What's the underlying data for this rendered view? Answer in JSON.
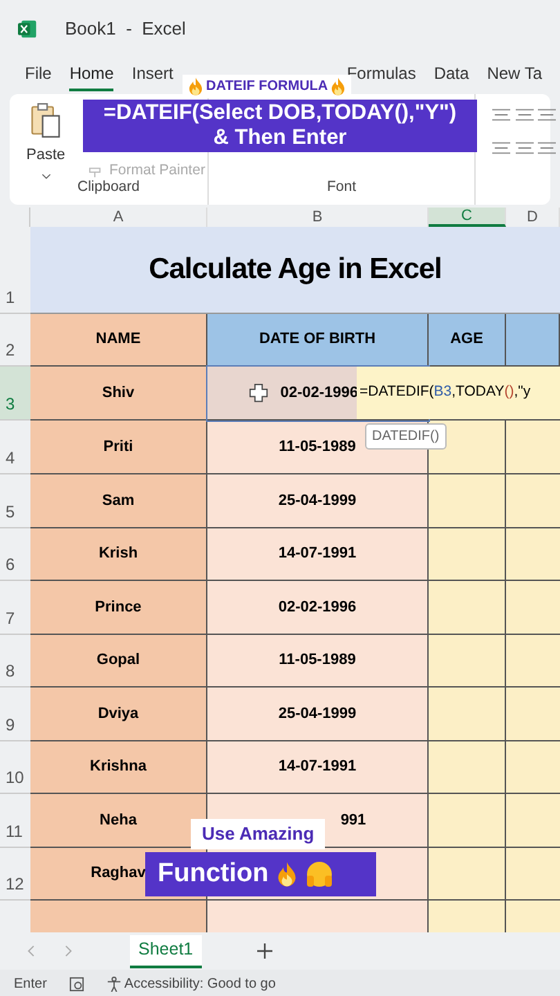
{
  "window": {
    "title": "Book1  -  Excel"
  },
  "ribbon_tabs": [
    {
      "label": "File",
      "selected": false
    },
    {
      "label": "Home",
      "selected": true
    },
    {
      "label": "Insert",
      "selected": false
    },
    {
      "label": "Formulas",
      "selected": false
    },
    {
      "label": "Data",
      "selected": false
    },
    {
      "label": "New Ta",
      "selected": false
    }
  ],
  "ribbon": {
    "paste": "Paste",
    "format_painter": "Format Painter",
    "groups": [
      "Clipboard",
      "Font"
    ]
  },
  "columns": [
    {
      "label": "A",
      "selected": false
    },
    {
      "label": "B",
      "selected": false
    },
    {
      "label": "C",
      "selected": true
    },
    {
      "label": "D",
      "selected": false
    }
  ],
  "sheet": {
    "header_rows": [
      "1",
      "2"
    ],
    "title": "Calculate Age in Excel",
    "headers": [
      "NAME",
      "DATE OF BIRTH",
      "AGE"
    ],
    "rows": [
      {
        "row": "3",
        "name": "Shiv",
        "dob": "02-02-1996",
        "selected": true
      },
      {
        "row": "4",
        "name": "Priti",
        "dob": "11-05-1989",
        "selected": false
      },
      {
        "row": "5",
        "name": "Sam",
        "dob": "25-04-1999",
        "selected": false
      },
      {
        "row": "6",
        "name": "Krish",
        "dob": "14-07-1991",
        "selected": false
      },
      {
        "row": "7",
        "name": "Prince",
        "dob": "02-02-1996",
        "selected": false
      },
      {
        "row": "8",
        "name": "Gopal",
        "dob": "11-05-1989",
        "selected": false
      },
      {
        "row": "9",
        "name": "Dviya",
        "dob": "25-04-1999",
        "selected": false
      },
      {
        "row": "10",
        "name": "Krishna",
        "dob": "14-07-1991",
        "selected": false
      },
      {
        "row": "11",
        "name": "Neha",
        "dob": "991",
        "selected": false
      },
      {
        "row": "12",
        "name": "Raghav",
        "selected": false
      }
    ],
    "formula_parts": [
      {
        "text": "=DATEDIF(",
        "kind": "plain"
      },
      {
        "text": "B3",
        "kind": "ref"
      },
      {
        "text": ",TODAY",
        "kind": "plain"
      },
      {
        "text": "()",
        "kind": "paren"
      },
      {
        "text": ",\"y",
        "kind": "plain"
      }
    ],
    "tooltip": "DATEDIF()"
  },
  "overlay": {
    "label": "DATEIF FORMULA",
    "caption": [
      "=DATEIF(Select DOB,TODAY(),\"Y\")",
      "& Then Enter"
    ],
    "bottom_label": "Use Amazing",
    "bottom_caption": "Function"
  },
  "sheet_tabs": [
    {
      "label": "Sheet1",
      "selected": true
    }
  ],
  "status_bar": {
    "mode": "Enter",
    "accessibility": "Accessibility: Good to go"
  }
}
